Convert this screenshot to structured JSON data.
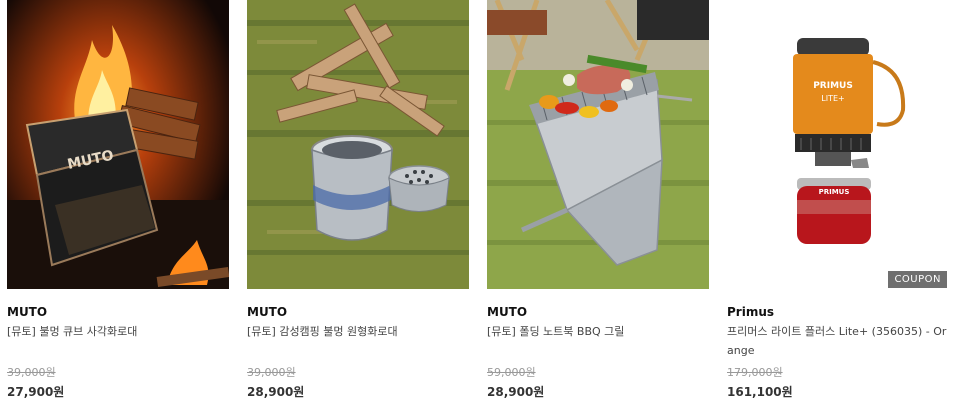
{
  "products": [
    {
      "brand": "MUTO",
      "name": "[뮤토] 불멍 큐브 사각화로대",
      "original_price": "39,000원",
      "sale_price": "27,900원"
    },
    {
      "brand": "MUTO",
      "name": "[뮤토] 감성캠핑 불멍 원형화로대",
      "original_price": "39,000원",
      "sale_price": "28,900원"
    },
    {
      "brand": "MUTO",
      "name": "[뮤토] 폴딩 노트북 BBQ 그릴",
      "original_price": "59,000원",
      "sale_price": "28,900원"
    },
    {
      "brand": "Primus",
      "name": "프리머스 라이트 플러스 Lite+ (356035) - Orange",
      "original_price": "179,000원",
      "sale_price": "161,100원",
      "badge": "COUPON",
      "label_top": "PRIMUS",
      "label_bottom": "LITE+"
    }
  ]
}
